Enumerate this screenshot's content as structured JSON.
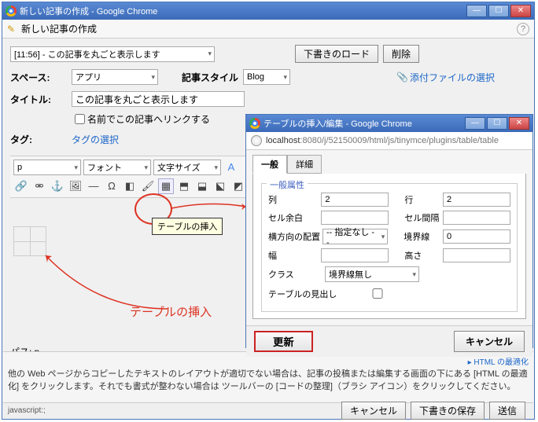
{
  "main_window": {
    "title": "新しい記事の作成 - Google Chrome",
    "subheader": "新しい記事の作成",
    "help": "?"
  },
  "draft_row": {
    "selected": "[11:56] - この記事を丸ごと表示します",
    "load_btn": "下書きのロード",
    "delete_btn": "削除"
  },
  "form": {
    "space_label": "スペース:",
    "space_value": "アプリ",
    "style_label": "記事スタイル",
    "style_value": "Blog",
    "attach": "添付ファイルの選択",
    "title_label": "タイトル:",
    "title_value": "この記事を丸ごと表示します",
    "name_link_cb": "名前でこの記事へリンクする",
    "tag_label": "タグ:",
    "tag_link": "タグの選択"
  },
  "toolbar": {
    "format": "p",
    "font": "フォント",
    "size": "文字サイズ"
  },
  "tooltip": "テーブルの挿入",
  "annotation": "テーブルの挿入",
  "path_label": "パス: p",
  "status": {
    "optimize": "▸ HTML の最適化",
    "help_text": "他の Web ページからコピーしたテキストのレイアウトが適切でない場合は、記事の投稿または編集する画面の下にある [HTML の最適化] をクリックします。それでも書式が整わない場合は ツールバーの [コードの整理]（ブラシ アイコン）をクリックしてください。"
  },
  "bottom": {
    "cancel": "キャンセル",
    "save_draft": "下書きの保存",
    "submit": "送信",
    "js": "javascript:;"
  },
  "dialog": {
    "title": "テーブルの挿入/編集 - Google Chrome",
    "url_prefix": "localhost",
    "url_rest": ":8080/j/52150009/html/js/tinymce/plugins/table/table",
    "tab_general": "一般",
    "tab_detail": "詳細",
    "legend": "一般属性",
    "cols_label": "列",
    "cols": "2",
    "rows_label": "行",
    "rows": "2",
    "cellpad_label": "セル余白",
    "cellpad": "",
    "cellspace_label": "セル間隔",
    "cellspace": "",
    "align_label": "横方向の配置",
    "align": "-- 指定なし --",
    "border_label": "境界線",
    "border": "0",
    "width_label": "幅",
    "width": "",
    "height_label": "高さ",
    "height": "",
    "class_label": "クラス",
    "class": "境界線無し",
    "caption_label": "テーブルの見出し",
    "update": "更新",
    "cancel": "キャンセル"
  }
}
